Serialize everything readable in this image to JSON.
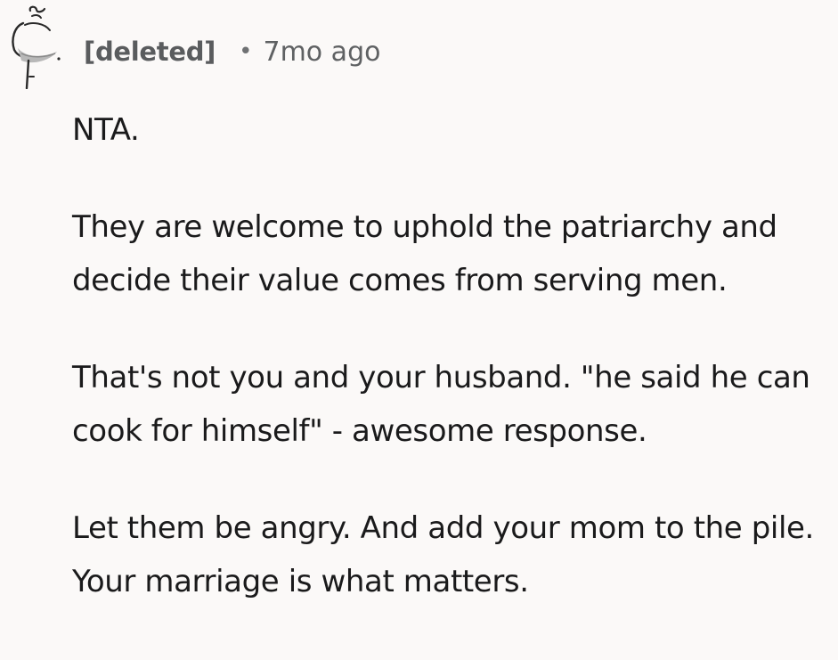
{
  "comment": {
    "author": "[deleted]",
    "separator": "•",
    "timestamp": "7mo ago",
    "avatar_icon": "deleted-user-avatar-icon",
    "paragraphs": [
      "NTA.",
      "They are welcome to uphold the patriarchy and decide their value comes from serving men.",
      "That's not you and your husband. \"he said he can cook for himself\" - awesome response.",
      "Let them be angry. And add your mom to the pile. Your marriage is what matters."
    ]
  },
  "colors": {
    "background": "#fbf9f8",
    "text": "#1a1a1b",
    "meta_text": "#5a5c5e"
  }
}
